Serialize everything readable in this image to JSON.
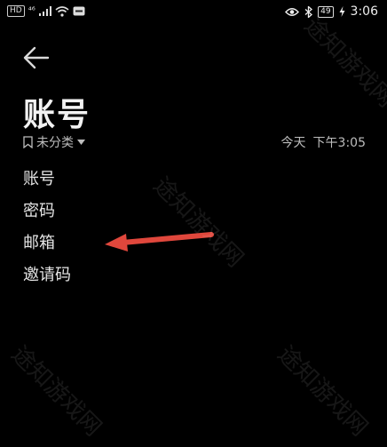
{
  "status_bar": {
    "hd": "HD",
    "signal_text": "⁴⁶",
    "battery": "49",
    "time": "3:06"
  },
  "page": {
    "title": "账号",
    "category": "未分类",
    "timestamp_day": "今天",
    "timestamp_time": "下午3:05"
  },
  "fields": [
    "账号",
    "密码",
    "邮箱",
    "邀请码"
  ],
  "watermark": "途知游戏网",
  "colors": {
    "arrow": "#e0473c",
    "background": "#000000"
  }
}
